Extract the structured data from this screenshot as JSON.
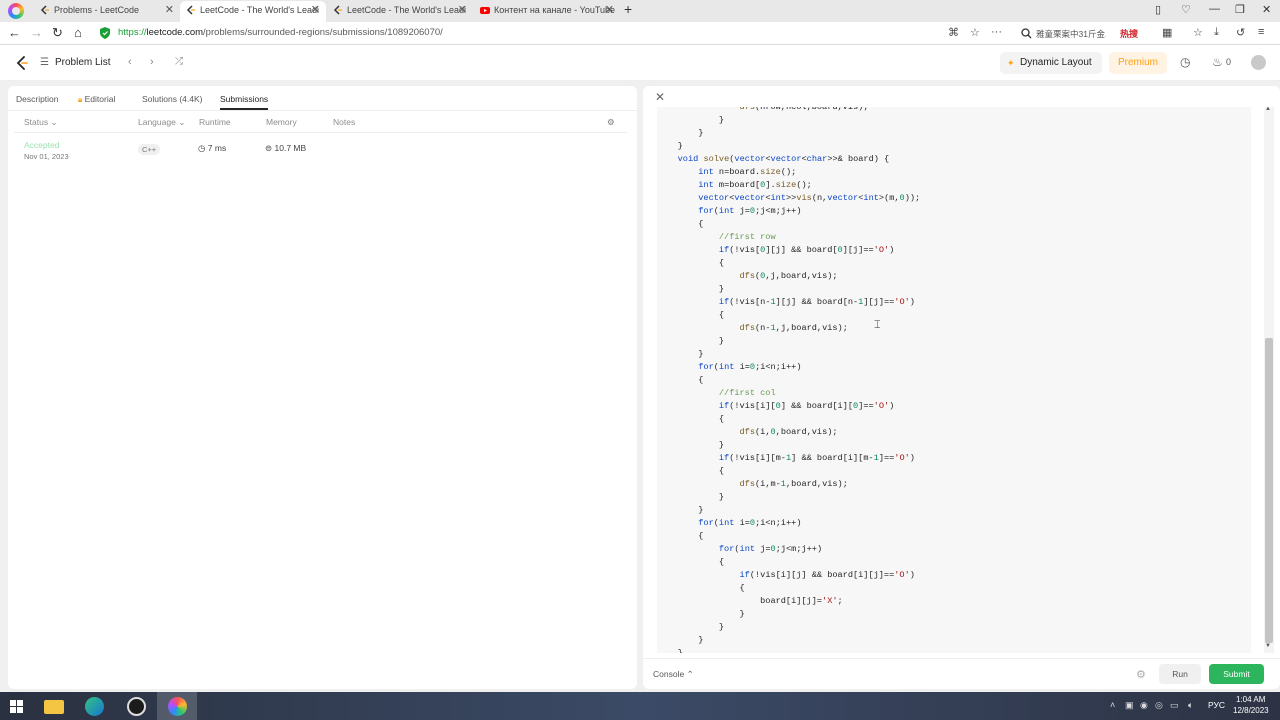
{
  "browser": {
    "tabs": [
      {
        "title": "Problems - LeetCode"
      },
      {
        "title": "LeetCode - The World's Leadi"
      },
      {
        "title": "LeetCode - The World's Leadi"
      },
      {
        "title": "Контент на канале - YouTube"
      }
    ],
    "url_scheme": "https://",
    "url_host": "leetcode.com",
    "url_path": "/problems/surrounded-regions/submissions/1089206070/",
    "search_text": "雅童栗案中31斤金...",
    "hot_label": "热搜"
  },
  "header": {
    "problem_list": "Problem List",
    "dynamic_layout": "Dynamic Layout",
    "premium": "Premium",
    "streak_count": "0"
  },
  "left": {
    "tabs": {
      "description": "Description",
      "editorial": "Editorial",
      "solutions": "Solutions (4.4K)",
      "submissions": "Submissions"
    },
    "columns": {
      "status": "Status",
      "language": "Language",
      "runtime": "Runtime",
      "memory": "Memory",
      "notes": "Notes"
    },
    "row": {
      "status": "Accepted",
      "date": "Nov 01, 2023",
      "language": "C++",
      "runtime": "7 ms",
      "memory": "10.7 MB"
    }
  },
  "right": {
    "console": "Console",
    "run": "Run",
    "submit": "Submit"
  },
  "taskbar": {
    "lang": "РУС",
    "time": "1:04 AM",
    "date": "12/8/2023"
  }
}
